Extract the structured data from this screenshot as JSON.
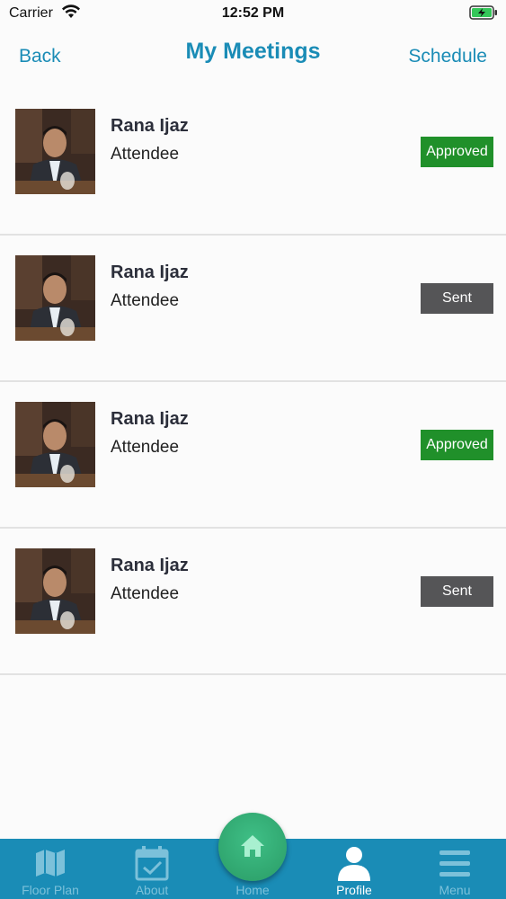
{
  "status_bar": {
    "carrier": "Carrier",
    "time": "12:52 PM"
  },
  "nav": {
    "back_label": "Back",
    "title": "My Meetings",
    "schedule_label": "Schedule"
  },
  "meetings": [
    {
      "name": "Rana Ijaz",
      "role": "Attendee",
      "status": "Approved"
    },
    {
      "name": "Rana Ijaz",
      "role": "Attendee",
      "status": "Sent"
    },
    {
      "name": "Rana Ijaz",
      "role": "Attendee",
      "status": "Approved"
    },
    {
      "name": "Rana Ijaz",
      "role": "Attendee",
      "status": "Sent"
    }
  ],
  "tabs": [
    {
      "label": "Floor Plan",
      "icon": "map-icon"
    },
    {
      "label": "About",
      "icon": "calendar-check-icon"
    },
    {
      "label": "Home",
      "icon": "home-icon"
    },
    {
      "label": "Profile",
      "icon": "person-icon"
    },
    {
      "label": "Menu",
      "icon": "hamburger-icon"
    }
  ],
  "colors": {
    "accent": "#1a8cb6",
    "approved": "#20902a",
    "sent": "#555557",
    "home_fab": "#34b078"
  }
}
